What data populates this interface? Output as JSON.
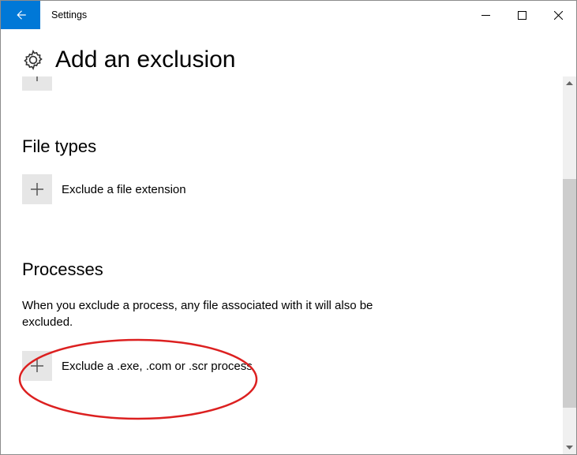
{
  "window": {
    "title": "Settings"
  },
  "page": {
    "title": "Add an exclusion"
  },
  "sections": {
    "file_types": {
      "heading": "File types",
      "add_label": "Exclude a file extension"
    },
    "processes": {
      "heading": "Processes",
      "description": "When you exclude a process, any file associated with it will also be excluded.",
      "add_label": "Exclude a .exe, .com or .scr process"
    }
  }
}
